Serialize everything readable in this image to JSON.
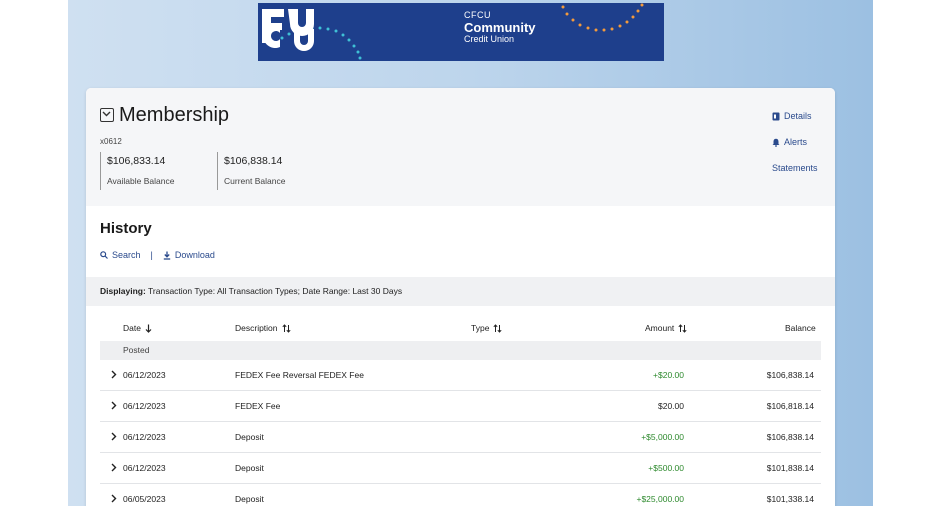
{
  "banner": {
    "brand_line1": "CFCU",
    "brand_line2": "Community",
    "brand_line3": "Credit Union",
    "bg_color": "#1e3f8c"
  },
  "account": {
    "title": "Membership",
    "number": "x0612",
    "available_balance": "$106,833.14",
    "available_label": "Available Balance",
    "current_balance": "$106,838.14",
    "current_label": "Current Balance",
    "links": [
      {
        "label": "Details",
        "icon": "details-icon"
      },
      {
        "label": "Alerts",
        "icon": "bell-icon"
      },
      {
        "label": "Statements",
        "icon": ""
      }
    ]
  },
  "history": {
    "title": "History",
    "search_label": "Search",
    "separator": "|",
    "download_label": "Download",
    "filter_prefix": "Displaying:",
    "filter_text": "Transaction Type: All Transaction Types; Date Range: Last 30 Days",
    "columns": {
      "date": "Date",
      "description": "Description",
      "type": "Type",
      "amount": "Amount",
      "balance": "Balance"
    },
    "group_label": "Posted",
    "rows": [
      {
        "date": "06/12/2023",
        "description": "FEDEX Fee Reversal FEDEX Fee",
        "type": "",
        "amount": "+$20.00",
        "balance": "$106,838.14"
      },
      {
        "date": "06/12/2023",
        "description": "FEDEX Fee",
        "type": "",
        "amount": "$20.00",
        "balance": "$106,818.14"
      },
      {
        "date": "06/12/2023",
        "description": "Deposit",
        "type": "",
        "amount": "+$5,000.00",
        "balance": "$106,838.14"
      },
      {
        "date": "06/12/2023",
        "description": "Deposit",
        "type": "",
        "amount": "+$500.00",
        "balance": "$101,838.14"
      },
      {
        "date": "06/05/2023",
        "description": "Deposit",
        "type": "",
        "amount": "+$25,000.00",
        "balance": "$101,338.14"
      }
    ]
  },
  "colors": {
    "link": "#2a4a8c",
    "positive": "#2e8a2e"
  }
}
